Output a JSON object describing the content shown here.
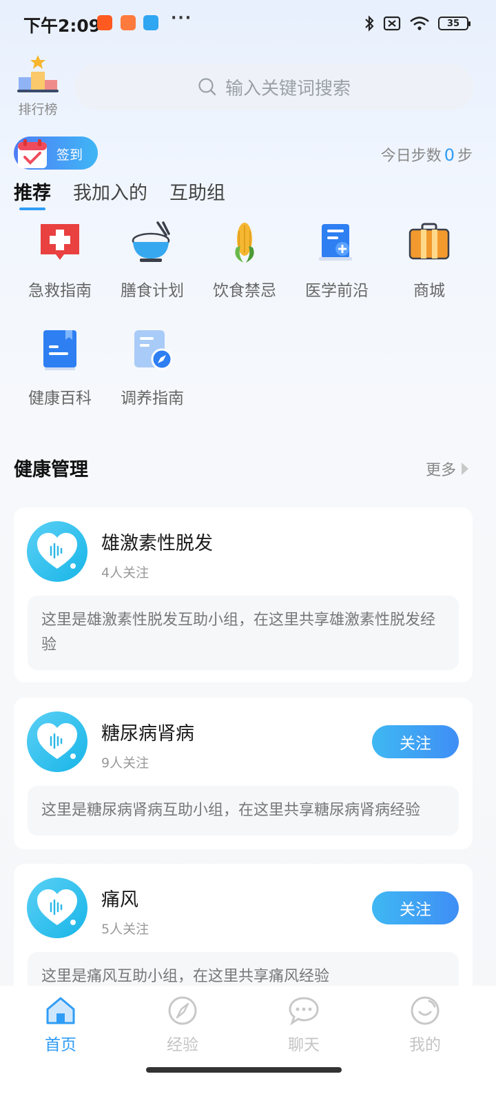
{
  "status_bar": {
    "time": "下午2:09",
    "battery": "35",
    "icons": [
      "taobao-app-icon",
      "shop-app-icon",
      "chat-app-icon",
      "bluetooth-icon",
      "sim-off-icon",
      "wifi-icon",
      "battery-icon"
    ]
  },
  "header": {
    "rank_label": "排行榜",
    "search_placeholder": "输入关键词搜索",
    "signin_label": "签到",
    "steps_prefix": "今日步数",
    "steps_value": "0",
    "steps_suffix": "步"
  },
  "tabs": [
    {
      "label": "推荐",
      "active": true
    },
    {
      "label": "我加入的",
      "active": false
    },
    {
      "label": "互助组",
      "active": false
    }
  ],
  "grid": [
    {
      "label": "急救指南",
      "icon": "first-aid-icon"
    },
    {
      "label": "膳食计划",
      "icon": "rice-bowl-icon"
    },
    {
      "label": "饮食禁忌",
      "icon": "corn-icon"
    },
    {
      "label": "医学前沿",
      "icon": "medical-document-icon"
    },
    {
      "label": "商城",
      "icon": "suitcase-icon"
    },
    {
      "label": "健康百科",
      "icon": "book-icon"
    },
    {
      "label": "调养指南",
      "icon": "compass-document-icon"
    }
  ],
  "section": {
    "title": "健康管理",
    "more": "更多"
  },
  "groups": [
    {
      "name": "雄激素性脱发",
      "count": "4人关注",
      "desc": "这里是雄激素性脱发互助小组，在这里共享雄激素性脱发经验",
      "follow": ""
    },
    {
      "name": "糖尿病肾病",
      "count": "9人关注",
      "desc": "这里是糖尿病肾病互助小组，在这里共享糖尿病肾病经验",
      "follow": "关注"
    },
    {
      "name": "痛风",
      "count": "5人关注",
      "desc": "这里是痛风互助小组，在这里共享痛风经验",
      "follow": "关注"
    }
  ],
  "bottom_nav": [
    {
      "label": "首页",
      "icon": "home-icon",
      "active": true
    },
    {
      "label": "经验",
      "icon": "compass-icon",
      "active": false
    },
    {
      "label": "聊天",
      "icon": "chat-bubble-icon",
      "active": false
    },
    {
      "label": "我的",
      "icon": "smile-icon",
      "active": false
    }
  ],
  "colors": {
    "accent": "#2f9cf5",
    "avatar": "#18b5e8",
    "text_muted": "#888888"
  }
}
